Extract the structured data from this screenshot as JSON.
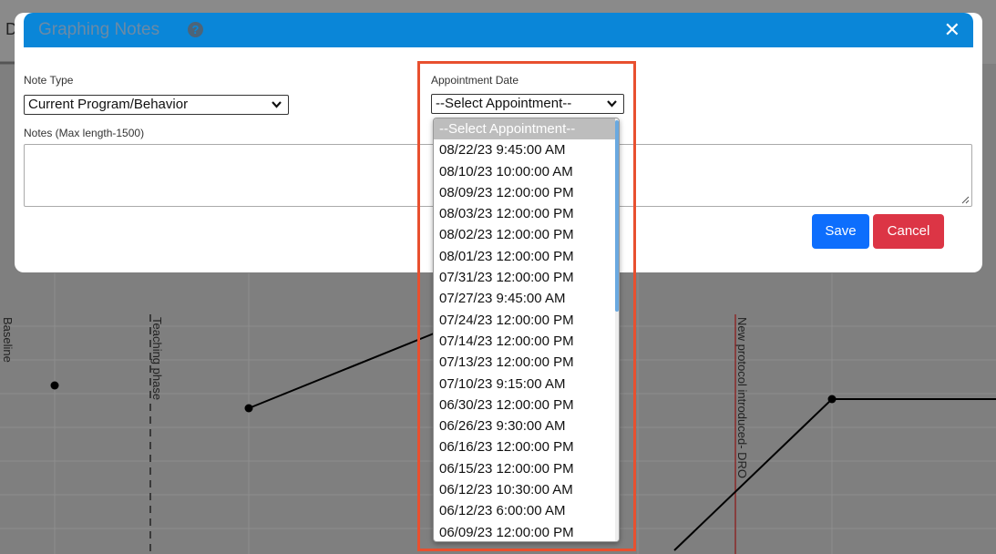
{
  "background": {
    "title_letter": "D",
    "phase_labels": [
      "Baseline",
      "Teaching phase",
      "New protocol introduced- DRO"
    ]
  },
  "modal": {
    "title": "Graphing Notes",
    "help_icon": "question-circle-icon",
    "close_icon": "close-icon",
    "note_type": {
      "label": "Note Type",
      "value": "Current Program/Behavior"
    },
    "appointment": {
      "label": "Appointment Date",
      "value": "--Select Appointment--",
      "options": [
        "--Select Appointment--",
        "08/22/23 9:45:00 AM",
        "08/10/23 10:00:00 AM",
        "08/09/23 12:00:00 PM",
        "08/03/23 12:00:00 PM",
        "08/02/23 12:00:00 PM",
        "08/01/23 12:00:00 PM",
        "07/31/23 12:00:00 PM",
        "07/27/23 9:45:00 AM",
        "07/24/23 12:00:00 PM",
        "07/14/23 12:00:00 PM",
        "07/13/23 12:00:00 PM",
        "07/10/23 9:15:00 AM",
        "06/30/23 12:00:00 PM",
        "06/26/23 9:30:00 AM",
        "06/16/23 12:00:00 PM",
        "06/15/23 12:00:00 PM",
        "06/12/23 10:30:00 AM",
        "06/12/23 6:00:00 AM",
        "06/09/23 12:00:00 PM"
      ]
    },
    "notes": {
      "label": "Notes (Max length-1500)",
      "value": ""
    },
    "save_label": "Save",
    "cancel_label": "Cancel"
  },
  "colors": {
    "header": "#0a86d8",
    "save": "#0d6efd",
    "cancel": "#dc3545",
    "highlight": "#e8502f"
  }
}
